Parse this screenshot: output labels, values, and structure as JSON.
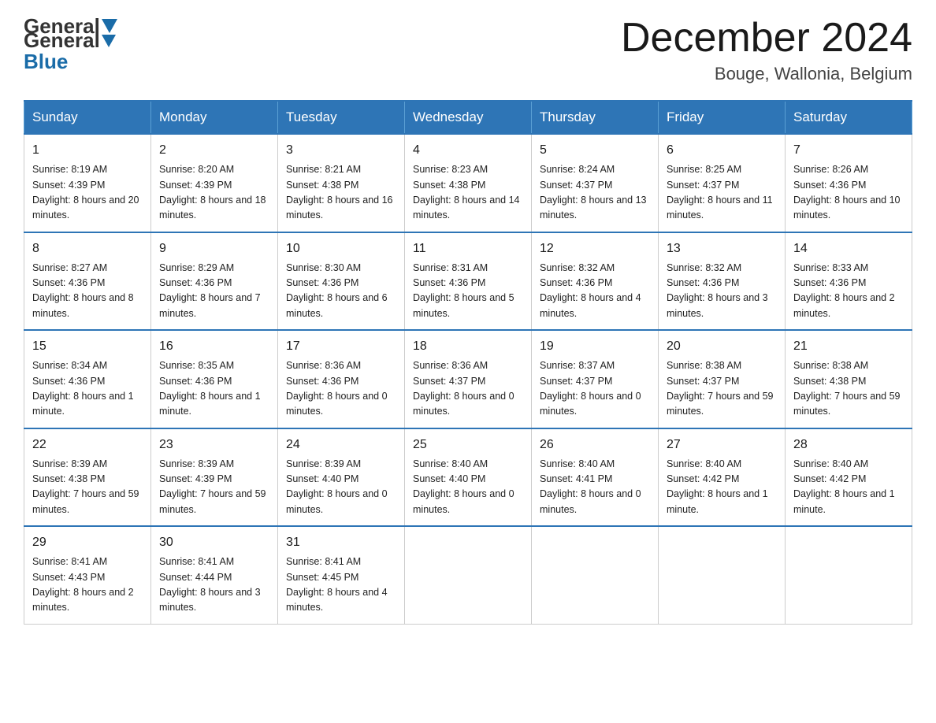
{
  "header": {
    "logo": {
      "general": "General",
      "blue": "Blue"
    },
    "title": "December 2024",
    "location": "Bouge, Wallonia, Belgium"
  },
  "days_of_week": [
    "Sunday",
    "Monday",
    "Tuesday",
    "Wednesday",
    "Thursday",
    "Friday",
    "Saturday"
  ],
  "weeks": [
    [
      {
        "day": "1",
        "sunrise": "8:19 AM",
        "sunset": "4:39 PM",
        "daylight": "8 hours and 20 minutes."
      },
      {
        "day": "2",
        "sunrise": "8:20 AM",
        "sunset": "4:39 PM",
        "daylight": "8 hours and 18 minutes."
      },
      {
        "day": "3",
        "sunrise": "8:21 AM",
        "sunset": "4:38 PM",
        "daylight": "8 hours and 16 minutes."
      },
      {
        "day": "4",
        "sunrise": "8:23 AM",
        "sunset": "4:38 PM",
        "daylight": "8 hours and 14 minutes."
      },
      {
        "day": "5",
        "sunrise": "8:24 AM",
        "sunset": "4:37 PM",
        "daylight": "8 hours and 13 minutes."
      },
      {
        "day": "6",
        "sunrise": "8:25 AM",
        "sunset": "4:37 PM",
        "daylight": "8 hours and 11 minutes."
      },
      {
        "day": "7",
        "sunrise": "8:26 AM",
        "sunset": "4:36 PM",
        "daylight": "8 hours and 10 minutes."
      }
    ],
    [
      {
        "day": "8",
        "sunrise": "8:27 AM",
        "sunset": "4:36 PM",
        "daylight": "8 hours and 8 minutes."
      },
      {
        "day": "9",
        "sunrise": "8:29 AM",
        "sunset": "4:36 PM",
        "daylight": "8 hours and 7 minutes."
      },
      {
        "day": "10",
        "sunrise": "8:30 AM",
        "sunset": "4:36 PM",
        "daylight": "8 hours and 6 minutes."
      },
      {
        "day": "11",
        "sunrise": "8:31 AM",
        "sunset": "4:36 PM",
        "daylight": "8 hours and 5 minutes."
      },
      {
        "day": "12",
        "sunrise": "8:32 AM",
        "sunset": "4:36 PM",
        "daylight": "8 hours and 4 minutes."
      },
      {
        "day": "13",
        "sunrise": "8:32 AM",
        "sunset": "4:36 PM",
        "daylight": "8 hours and 3 minutes."
      },
      {
        "day": "14",
        "sunrise": "8:33 AM",
        "sunset": "4:36 PM",
        "daylight": "8 hours and 2 minutes."
      }
    ],
    [
      {
        "day": "15",
        "sunrise": "8:34 AM",
        "sunset": "4:36 PM",
        "daylight": "8 hours and 1 minute."
      },
      {
        "day": "16",
        "sunrise": "8:35 AM",
        "sunset": "4:36 PM",
        "daylight": "8 hours and 1 minute."
      },
      {
        "day": "17",
        "sunrise": "8:36 AM",
        "sunset": "4:36 PM",
        "daylight": "8 hours and 0 minutes."
      },
      {
        "day": "18",
        "sunrise": "8:36 AM",
        "sunset": "4:37 PM",
        "daylight": "8 hours and 0 minutes."
      },
      {
        "day": "19",
        "sunrise": "8:37 AM",
        "sunset": "4:37 PM",
        "daylight": "8 hours and 0 minutes."
      },
      {
        "day": "20",
        "sunrise": "8:38 AM",
        "sunset": "4:37 PM",
        "daylight": "7 hours and 59 minutes."
      },
      {
        "day": "21",
        "sunrise": "8:38 AM",
        "sunset": "4:38 PM",
        "daylight": "7 hours and 59 minutes."
      }
    ],
    [
      {
        "day": "22",
        "sunrise": "8:39 AM",
        "sunset": "4:38 PM",
        "daylight": "7 hours and 59 minutes."
      },
      {
        "day": "23",
        "sunrise": "8:39 AM",
        "sunset": "4:39 PM",
        "daylight": "7 hours and 59 minutes."
      },
      {
        "day": "24",
        "sunrise": "8:39 AM",
        "sunset": "4:40 PM",
        "daylight": "8 hours and 0 minutes."
      },
      {
        "day": "25",
        "sunrise": "8:40 AM",
        "sunset": "4:40 PM",
        "daylight": "8 hours and 0 minutes."
      },
      {
        "day": "26",
        "sunrise": "8:40 AM",
        "sunset": "4:41 PM",
        "daylight": "8 hours and 0 minutes."
      },
      {
        "day": "27",
        "sunrise": "8:40 AM",
        "sunset": "4:42 PM",
        "daylight": "8 hours and 1 minute."
      },
      {
        "day": "28",
        "sunrise": "8:40 AM",
        "sunset": "4:42 PM",
        "daylight": "8 hours and 1 minute."
      }
    ],
    [
      {
        "day": "29",
        "sunrise": "8:41 AM",
        "sunset": "4:43 PM",
        "daylight": "8 hours and 2 minutes."
      },
      {
        "day": "30",
        "sunrise": "8:41 AM",
        "sunset": "4:44 PM",
        "daylight": "8 hours and 3 minutes."
      },
      {
        "day": "31",
        "sunrise": "8:41 AM",
        "sunset": "4:45 PM",
        "daylight": "8 hours and 4 minutes."
      },
      null,
      null,
      null,
      null
    ]
  ]
}
